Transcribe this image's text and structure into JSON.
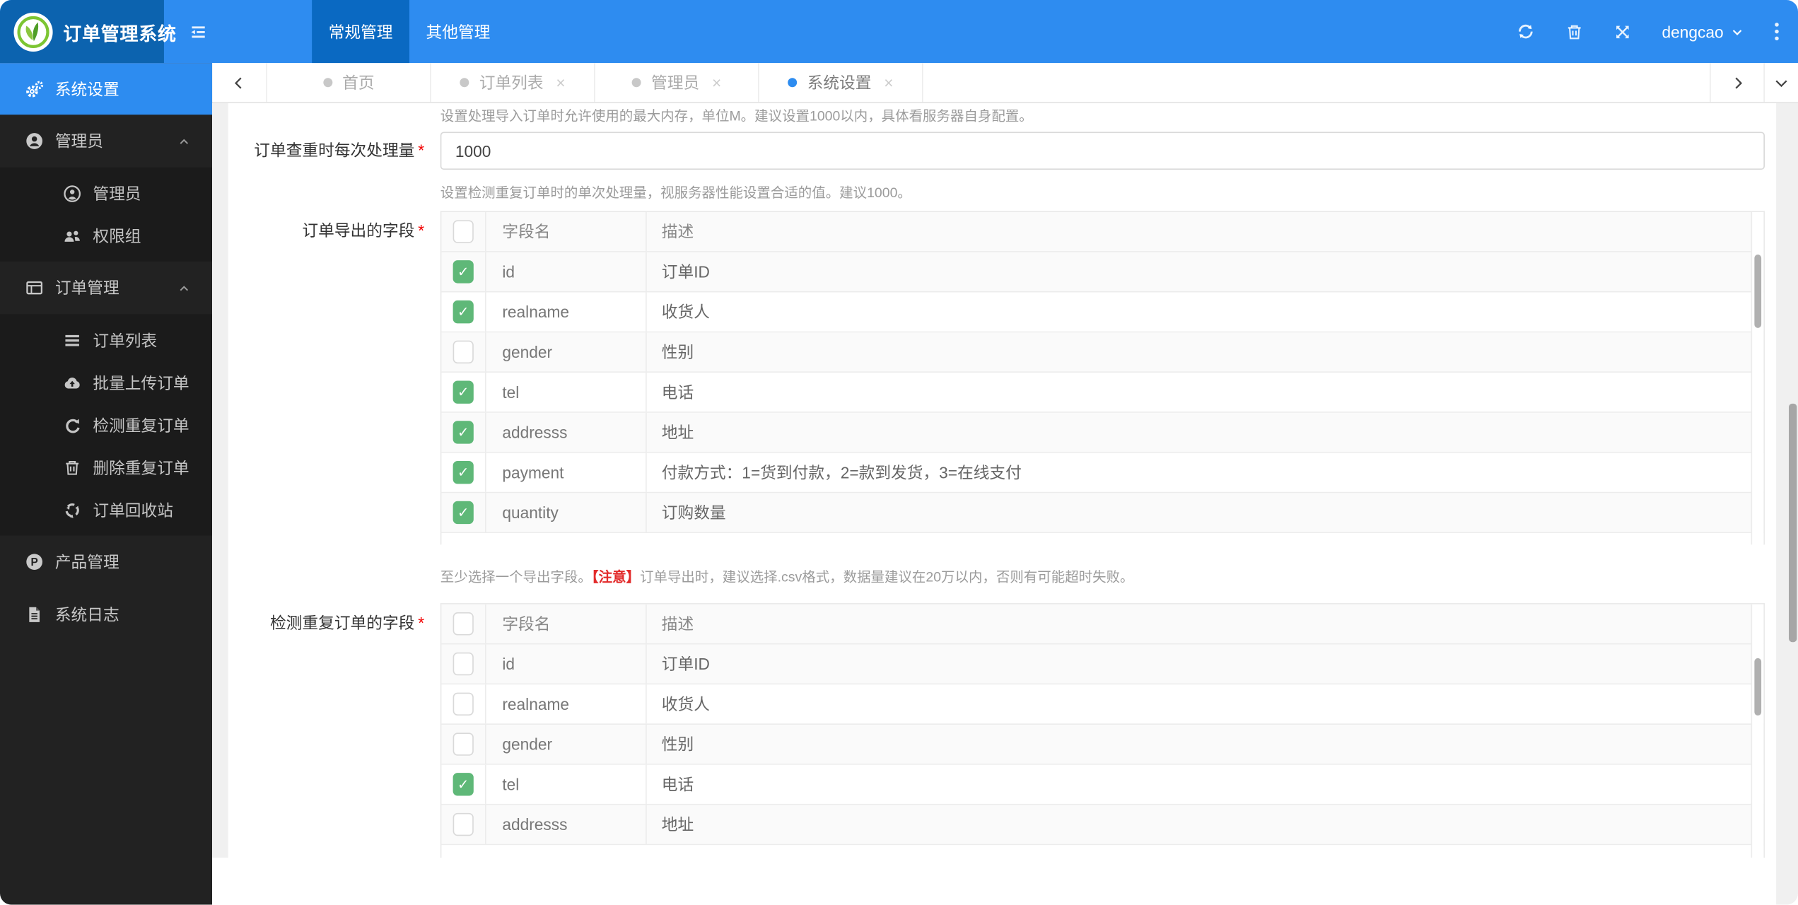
{
  "app": {
    "title": "订单管理系统"
  },
  "header": {
    "nav": [
      {
        "label": "常规管理"
      },
      {
        "label": "其他管理"
      }
    ],
    "username": "dengcao"
  },
  "tabs": {
    "close_glyph": "×",
    "items": [
      {
        "label": "首页",
        "closable": false,
        "active": false
      },
      {
        "label": "订单列表",
        "closable": true,
        "active": false
      },
      {
        "label": "管理员",
        "closable": true,
        "active": false
      },
      {
        "label": "系统设置",
        "closable": true,
        "active": true
      }
    ]
  },
  "sidebar": {
    "system_settings": "系统设置",
    "admin_group": "管理员",
    "admin": "管理员",
    "perm_group": "权限组",
    "order_group": "订单管理",
    "order_list": "订单列表",
    "batch_upload": "批量上传订单",
    "detect_dup": "检测重复订单",
    "delete_dup": "删除重复订单",
    "order_recycle": "订单回收站",
    "product": "产品管理",
    "syslog": "系统日志"
  },
  "form": {
    "memory_help": "设置处理导入订单时允许使用的最大内存，单位M。建议设置1000以内，具体看服务器自身配置。",
    "batch_label": "订单查重时每次处理量",
    "required": "*",
    "batch_value": "1000",
    "batch_help": "设置检测重复订单时的单次处理量，视服务器性能设置合适的值。建议1000。",
    "export_label": "订单导出的字段",
    "export_note_prefix": "至少选择一个导出字段。",
    "export_note_warn": "【注意】",
    "export_note_suffix": "订单导出时，建议选择.csv格式，数据量建议在20万以内，否则有可能超时失败。",
    "detect_label": "检测重复订单的字段"
  },
  "export_table": {
    "headers": {
      "name": "字段名",
      "desc": "描述"
    },
    "rows": [
      {
        "field": "id",
        "desc": "订单ID",
        "checked": true
      },
      {
        "field": "realname",
        "desc": "收货人",
        "checked": true
      },
      {
        "field": "gender",
        "desc": "性别",
        "checked": false
      },
      {
        "field": "tel",
        "desc": "电话",
        "checked": true
      },
      {
        "field": "addresss",
        "desc": "地址",
        "checked": true
      },
      {
        "field": "payment",
        "desc": "付款方式：1=货到付款，2=款到发货，3=在线支付",
        "checked": true
      },
      {
        "field": "quantity",
        "desc": "订购数量",
        "checked": true
      }
    ]
  },
  "detect_table": {
    "headers": {
      "name": "字段名",
      "desc": "描述"
    },
    "rows": [
      {
        "field": "id",
        "desc": "订单ID",
        "checked": false
      },
      {
        "field": "realname",
        "desc": "收货人",
        "checked": false
      },
      {
        "field": "gender",
        "desc": "性别",
        "checked": false
      },
      {
        "field": "tel",
        "desc": "电话",
        "checked": true
      },
      {
        "field": "addresss",
        "desc": "地址",
        "checked": false
      }
    ]
  },
  "colors": {
    "primary": "#2d8cf0",
    "checkbox_green": "#5FB878",
    "logo_bg": "#0c63af"
  }
}
